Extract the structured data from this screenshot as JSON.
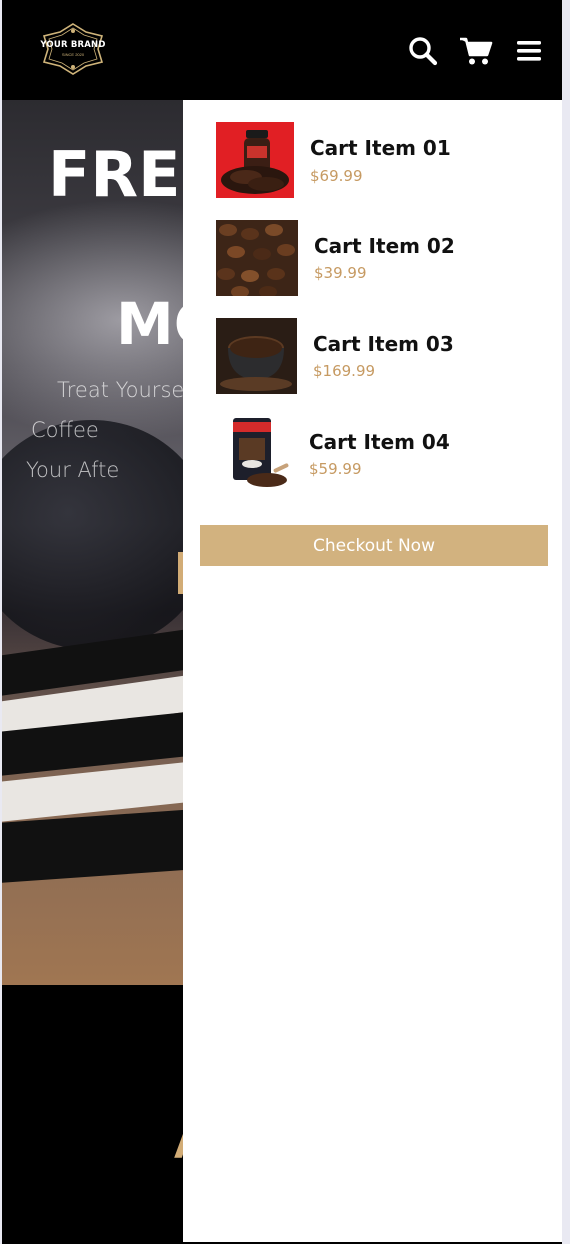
{
  "brand": {
    "name": "YOUR BRAND",
    "tagline": "SINCE 2020",
    "gold": "#cfb47a"
  },
  "header": {
    "icons": [
      "search-icon",
      "cart-icon",
      "menu-icon"
    ]
  },
  "hero": {
    "title_top": "FRES",
    "title_bottom": "MC",
    "lines": [
      "Treat Yoursel",
      "Coffee",
      "Your Afte"
    ]
  },
  "below": {
    "text": "A"
  },
  "cart": {
    "items": [
      {
        "name": "Cart Item 01",
        "price": "$69.99"
      },
      {
        "name": "Cart Item 02",
        "price": "$39.99"
      },
      {
        "name": "Cart Item 03",
        "price": "$169.99"
      },
      {
        "name": "Cart Item 04",
        "price": "$59.99"
      }
    ],
    "checkout_label": "Checkout Now",
    "accent": "#d2b27f",
    "price_color": "#c69a62"
  }
}
